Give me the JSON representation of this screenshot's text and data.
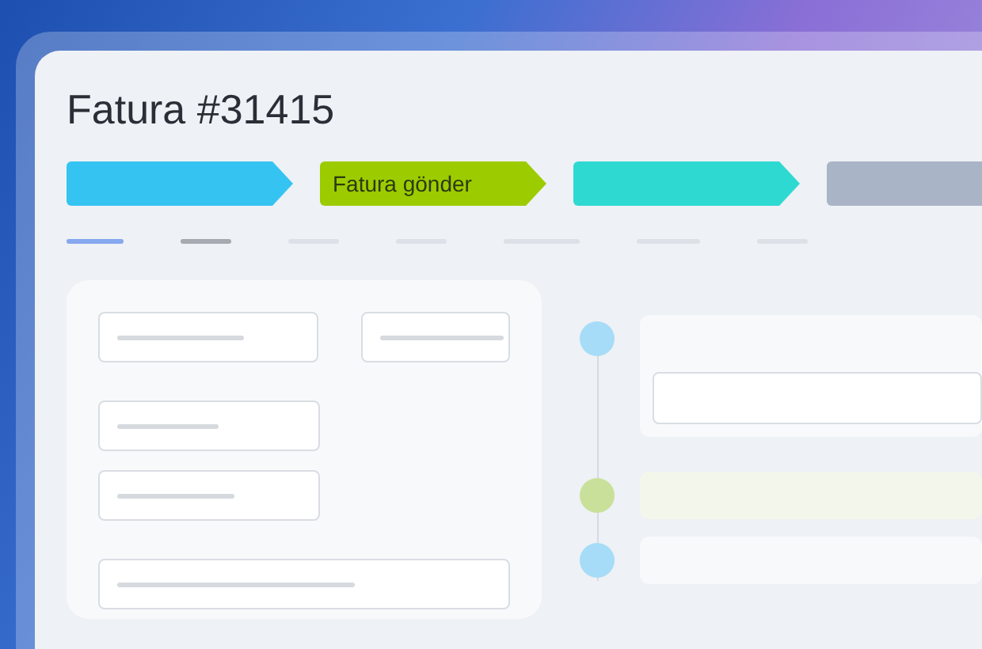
{
  "window": {
    "title": "Fatura #31415"
  },
  "steps": [
    {
      "color": "#35c4f2"
    },
    {
      "label": "Fatura gönder",
      "color": "#9ccc00"
    },
    {
      "color": "#2ed9d2"
    },
    {
      "color": "#a9b4c6"
    }
  ],
  "tabs": [
    {
      "selected": true
    },
    {
      "selected": false
    },
    {
      "selected": false
    },
    {
      "selected": false
    },
    {
      "selected": false
    },
    {
      "selected": false
    },
    {
      "selected": false
    }
  ],
  "timeline": [
    {
      "color": "#a6dcf7",
      "kind": "field"
    },
    {
      "color": "#c9e09a",
      "kind": "plain"
    },
    {
      "color": "#a6dcf7",
      "kind": "plain"
    }
  ]
}
